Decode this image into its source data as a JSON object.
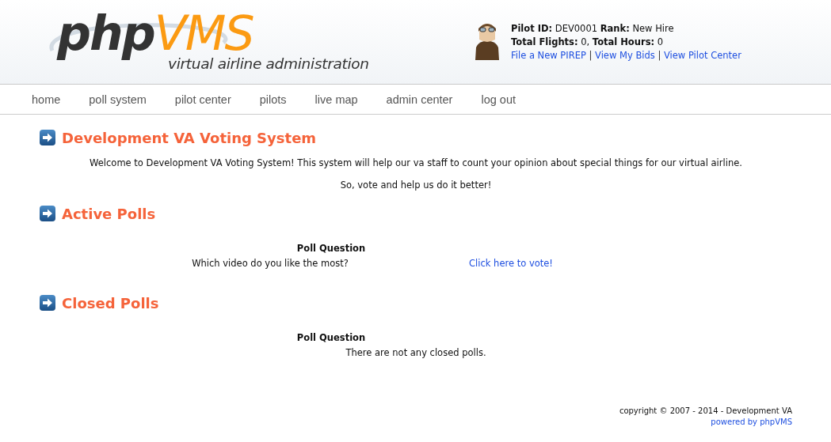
{
  "logo": {
    "brand_dark": "php",
    "brand_accent": "VMS",
    "tagline": "virtual airline administration"
  },
  "pilot": {
    "lines": [
      "**Pilot ID:** DEV0001 **Rank:** New Hire",
      "**Total Flights:** 0, **Total Hours:** 0"
    ],
    "links": [
      {
        "kind": "link",
        "text": "File a New PIREP"
      },
      {
        "kind": "separator",
        "text": "|"
      },
      {
        "kind": "link",
        "text": "View My Bids"
      },
      {
        "kind": "separator",
        "text": "|"
      },
      {
        "kind": "link",
        "text": "View Pilot Center"
      }
    ]
  },
  "nav": {
    "items": [
      "home",
      "poll system",
      "pilot center",
      "pilots",
      "live map",
      "admin center",
      "log out"
    ]
  },
  "sections": [
    {
      "title": "Development VA Voting System",
      "kind": "text",
      "paragraphs": [
        "Welcome to Development VA Voting System! This system will help our va staff to count your opinion about special things for our virtual airline.",
        "So, vote and help us do it better!"
      ]
    },
    {
      "title": "Active Polls",
      "kind": "table",
      "header": "Poll Question",
      "rows": [
        {
          "question": "Which video do you like the most?",
          "link": "Click here to vote!"
        }
      ]
    },
    {
      "title": "Closed Polls",
      "kind": "empty",
      "header": "Poll Question",
      "message": "There are not any closed polls."
    }
  ],
  "footer": {
    "copyright": "copyright © 2007 - 2014 - Development VA",
    "powered": "powered by phpVMS"
  }
}
